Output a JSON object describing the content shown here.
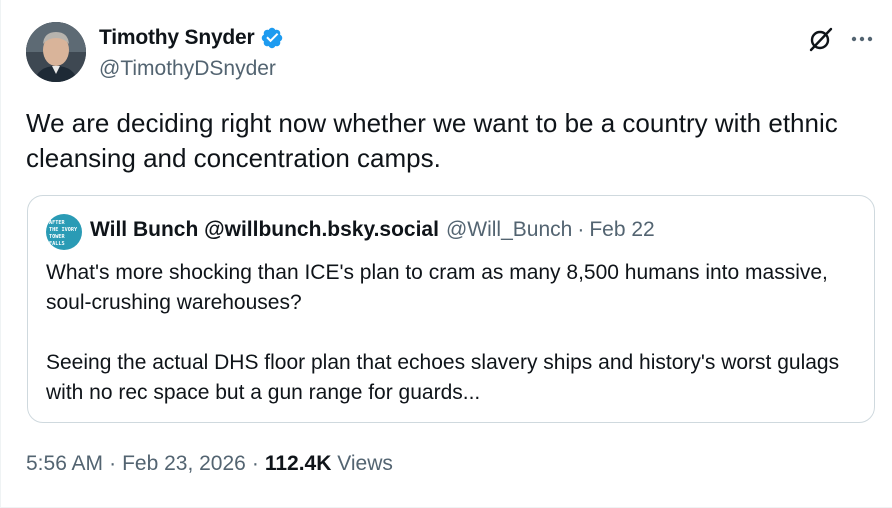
{
  "author": {
    "display_name": "Timothy Snyder",
    "handle": "@TimothyDSnyder",
    "verified": true
  },
  "tweet": {
    "text": "We are deciding right now whether we want to be a country with ethnic cleansing and concentration camps."
  },
  "quoted": {
    "author_name": "Will Bunch @willbunch.bsky.social",
    "handle": "@Will_Bunch",
    "separator": "·",
    "date": "Feb 22",
    "avatar_text": "AFTER THE IVORY TOWER FALLS",
    "paragraphs": [
      "What's more shocking than ICE's plan to cram as many 8,500 humans into massive, soul-crushing warehouses?",
      "Seeing the actual DHS floor plan that echoes slavery ships and history's worst gulags with no rec space but a gun range for guards..."
    ]
  },
  "meta": {
    "time": "5:56 AM",
    "separator": "·",
    "date": "Feb 23, 2026",
    "views_count": "112.4K",
    "views_label": "Views"
  },
  "icons": {
    "verified": "verified-badge-icon",
    "grok": "grok-icon",
    "more": "more-options-icon"
  },
  "colors": {
    "text": "#0f1419",
    "secondary": "#536471",
    "verified": "#1d9bf0",
    "border": "#cfd9de"
  }
}
